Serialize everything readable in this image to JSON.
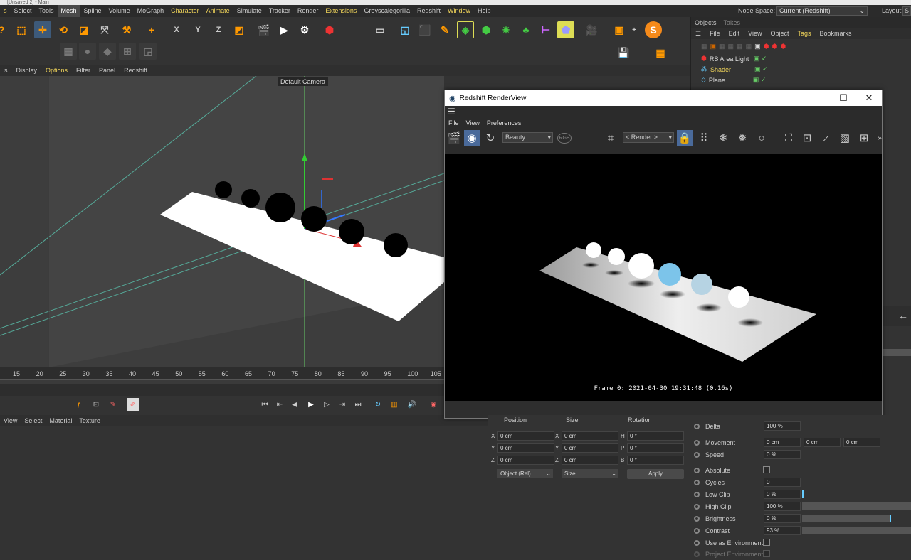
{
  "topstrip": {
    "text": "[Unsaved 2] - Main"
  },
  "menubar": {
    "items": [
      {
        "label": "s",
        "style": "y"
      },
      {
        "label": "Select"
      },
      {
        "label": "Tools"
      },
      {
        "label": "Mesh",
        "style": "act"
      },
      {
        "label": "Spline"
      },
      {
        "label": "Volume"
      },
      {
        "label": "MoGraph"
      },
      {
        "label": "Character",
        "style": "y"
      },
      {
        "label": "Animate",
        "style": "y"
      },
      {
        "label": "Simulate"
      },
      {
        "label": "Tracker"
      },
      {
        "label": "Render"
      },
      {
        "label": "Extensions",
        "style": "y"
      },
      {
        "label": "Greyscalegorilla"
      },
      {
        "label": "Redshift"
      },
      {
        "label": "Window",
        "style": "y"
      },
      {
        "label": "Help"
      }
    ],
    "node_space_label": "Node Space:",
    "node_space_value": "Current (Redshift)",
    "layout_label": "Layout:",
    "layout_value": "S"
  },
  "viewport_menu": {
    "items": [
      "s",
      "Display",
      "Options",
      "Filter",
      "Panel",
      "Redshift"
    ]
  },
  "viewport": {
    "camera_label": "Default Camera"
  },
  "timeline": {
    "ticks": [
      "15",
      "20",
      "25",
      "30",
      "35",
      "40",
      "45",
      "50",
      "55",
      "60",
      "65",
      "70",
      "75",
      "80",
      "85",
      "90",
      "95",
      "100",
      "105"
    ]
  },
  "material_menu": {
    "items": [
      "View",
      "Select",
      "Material",
      "Texture"
    ]
  },
  "objects": {
    "tabs": [
      "Objects",
      "Takes"
    ],
    "menu": [
      "File",
      "Edit",
      "View",
      "Object",
      "Tags",
      "Bookmarks"
    ],
    "rows": [
      {
        "name": "RS Area Light",
        "style": ""
      },
      {
        "name": "Shader",
        "style": "y"
      },
      {
        "name": "Plane",
        "style": ""
      }
    ]
  },
  "renderview": {
    "title": "Redshift RenderView",
    "menu": [
      "File",
      "View",
      "Preferences"
    ],
    "aov": "Beauty",
    "render_mode": "< Render >",
    "rgb": "RGB",
    "frame_info": "Frame  0:  2021-04-30  19:31:48  (0.16s)"
  },
  "coords": {
    "headers": [
      "Position",
      "Size",
      "Rotation"
    ],
    "rows": [
      {
        "pl": "X",
        "pv": "0 cm",
        "sl": "X",
        "sv": "0 cm",
        "rl": "H",
        "rv": "0 °"
      },
      {
        "pl": "Y",
        "pv": "0 cm",
        "sl": "Y",
        "sv": "0 cm",
        "rl": "P",
        "rv": "0 °"
      },
      {
        "pl": "Z",
        "pv": "0 cm",
        "sl": "Z",
        "sv": "0 cm",
        "rl": "B",
        "rv": "0 °"
      }
    ],
    "mode": "Object (Rel)",
    "size_mode": "Size",
    "apply": "Apply"
  },
  "props": {
    "delta": {
      "label": "Delta",
      "value": "100 %"
    },
    "movement": {
      "label": "Movement",
      "v1": "0 cm",
      "v2": "0 cm",
      "v3": "0 cm"
    },
    "speed": {
      "label": "Speed",
      "value": "0 %"
    },
    "absolute": {
      "label": "Absolute"
    },
    "cycles": {
      "label": "Cycles",
      "value": "0"
    },
    "low_clip": {
      "label": "Low Clip",
      "value": "0 %"
    },
    "high_clip": {
      "label": "High Clip",
      "value": "100 %"
    },
    "brightness": {
      "label": "Brightness",
      "value": "0 %"
    },
    "contrast": {
      "label": "Contrast",
      "value": "93 %"
    },
    "use_env": {
      "label": "Use as Environment"
    },
    "proj_env": {
      "label": "Project Environment"
    }
  }
}
